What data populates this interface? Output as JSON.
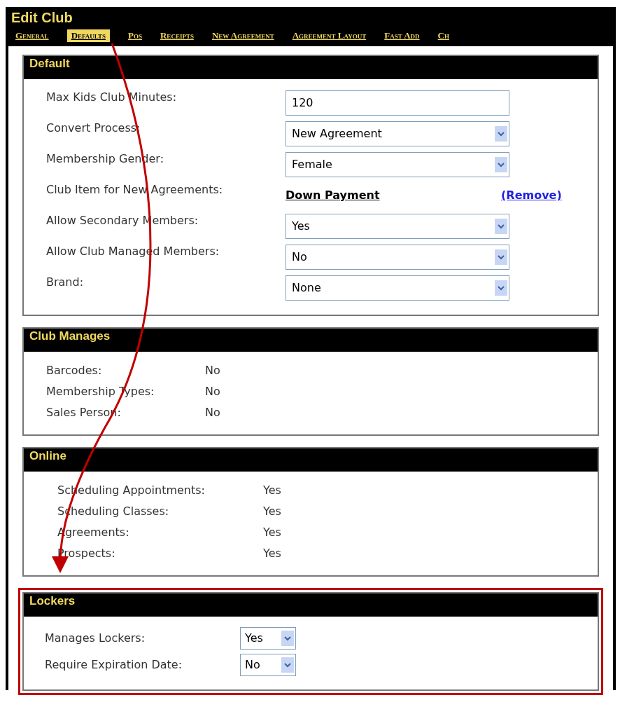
{
  "window": {
    "title": "Edit Club"
  },
  "tabs": [
    {
      "label": "General",
      "selected": false
    },
    {
      "label": "Defaults",
      "selected": true
    },
    {
      "label": "Pos",
      "selected": false
    },
    {
      "label": "Receipts",
      "selected": false
    },
    {
      "label": "New Agreement",
      "selected": false
    },
    {
      "label": "Agreement Layout",
      "selected": false
    },
    {
      "label": "Fast Add",
      "selected": false
    },
    {
      "label": "Ch",
      "selected": false
    }
  ],
  "sections": [
    {
      "title": "Default",
      "highlighted": false,
      "rows": [
        {
          "kind": "input",
          "label": "Max Kids Club Minutes:",
          "value": "120"
        },
        {
          "kind": "select",
          "label": "Convert Process:",
          "value": "New Agreement"
        },
        {
          "kind": "select",
          "label": "Membership Gender:",
          "value": "Female"
        },
        {
          "kind": "link",
          "label": "Club Item for New Agreements:",
          "value": "Down Payment",
          "action": "(Remove)"
        },
        {
          "kind": "select",
          "label": "Allow Secondary Members:",
          "value": "Yes"
        },
        {
          "kind": "select",
          "label": "Allow Club Managed Members:",
          "value": "No"
        },
        {
          "kind": "select",
          "label": "Brand:",
          "value": "None"
        }
      ]
    },
    {
      "title": "Club Manages",
      "highlighted": false,
      "rows": [
        {
          "kind": "value",
          "label": "Barcodes:",
          "value": "No"
        },
        {
          "kind": "value",
          "label": "Membership Types:",
          "value": "No"
        },
        {
          "kind": "value",
          "label": "Sales Person:",
          "value": "No"
        }
      ]
    },
    {
      "title": "Online",
      "highlighted": false,
      "rows": [
        {
          "kind": "value2",
          "label": "Scheduling Appointments:",
          "value": "Yes"
        },
        {
          "kind": "value2",
          "label": "Scheduling Classes:",
          "value": "Yes"
        },
        {
          "kind": "value2",
          "label": "Agreements:",
          "value": "Yes"
        },
        {
          "kind": "value2",
          "label": "Prospects:",
          "value": "Yes"
        }
      ]
    },
    {
      "title": "Lockers",
      "highlighted": true,
      "rows": [
        {
          "kind": "smallselect",
          "label": "Manages Lockers:",
          "value": "Yes"
        },
        {
          "kind": "smallselect",
          "label": "Require Expiration Date:",
          "value": "No"
        }
      ]
    }
  ]
}
